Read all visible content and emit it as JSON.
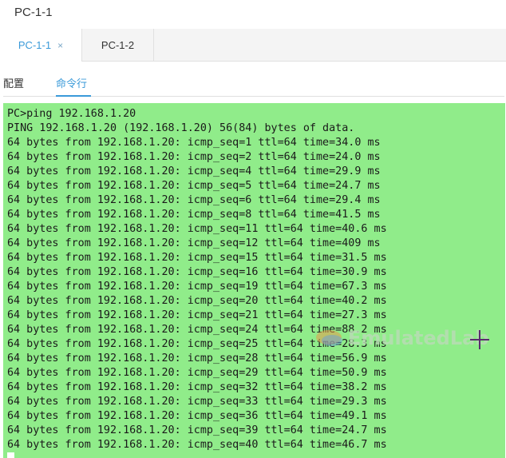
{
  "window": {
    "title": "PC-1-1"
  },
  "tabs": [
    {
      "label": "PC-1-1",
      "close": "×",
      "active": true
    },
    {
      "label": "PC-1-2",
      "active": false
    }
  ],
  "subtabs": {
    "config_label": "配置",
    "cmd_label": "命令行"
  },
  "terminal": {
    "lines": [
      "PC>ping 192.168.1.20",
      "PING 192.168.1.20 (192.168.1.20) 56(84) bytes of data.",
      "64 bytes from 192.168.1.20: icmp_seq=1 ttl=64 time=34.0 ms",
      "64 bytes from 192.168.1.20: icmp_seq=2 ttl=64 time=24.0 ms",
      "64 bytes from 192.168.1.20: icmp_seq=4 ttl=64 time=29.9 ms",
      "64 bytes from 192.168.1.20: icmp_seq=5 ttl=64 time=24.7 ms",
      "64 bytes from 192.168.1.20: icmp_seq=6 ttl=64 time=29.4 ms",
      "64 bytes from 192.168.1.20: icmp_seq=8 ttl=64 time=41.5 ms",
      "64 bytes from 192.168.1.20: icmp_seq=11 ttl=64 time=40.6 ms",
      "64 bytes from 192.168.1.20: icmp_seq=12 ttl=64 time=409 ms",
      "64 bytes from 192.168.1.20: icmp_seq=15 ttl=64 time=31.5 ms",
      "64 bytes from 192.168.1.20: icmp_seq=16 ttl=64 time=30.9 ms",
      "64 bytes from 192.168.1.20: icmp_seq=19 ttl=64 time=67.3 ms",
      "64 bytes from 192.168.1.20: icmp_seq=20 ttl=64 time=40.2 ms",
      "64 bytes from 192.168.1.20: icmp_seq=21 ttl=64 time=27.3 ms",
      "64 bytes from 192.168.1.20: icmp_seq=24 ttl=64 time=88.2 ms",
      "64 bytes from 192.168.1.20: icmp_seq=25 ttl=64 time=28.3 ms",
      "64 bytes from 192.168.1.20: icmp_seq=28 ttl=64 time=56.9 ms",
      "64 bytes from 192.168.1.20: icmp_seq=29 ttl=64 time=50.9 ms",
      "64 bytes from 192.168.1.20: icmp_seq=32 ttl=64 time=38.2 ms",
      "64 bytes from 192.168.1.20: icmp_seq=33 ttl=64 time=29.3 ms",
      "64 bytes from 192.168.1.20: icmp_seq=36 ttl=64 time=49.1 ms",
      "64 bytes from 192.168.1.20: icmp_seq=39 ttl=64 time=24.7 ms",
      "64 bytes from 192.168.1.20: icmp_seq=40 ttl=64 time=46.7 ms"
    ]
  },
  "watermark": {
    "text": "EmulatedLab"
  },
  "colors": {
    "accent": "#3a9ad9",
    "terminal_bg": "#90ec8a",
    "crosshair": "#5a2d6e"
  }
}
